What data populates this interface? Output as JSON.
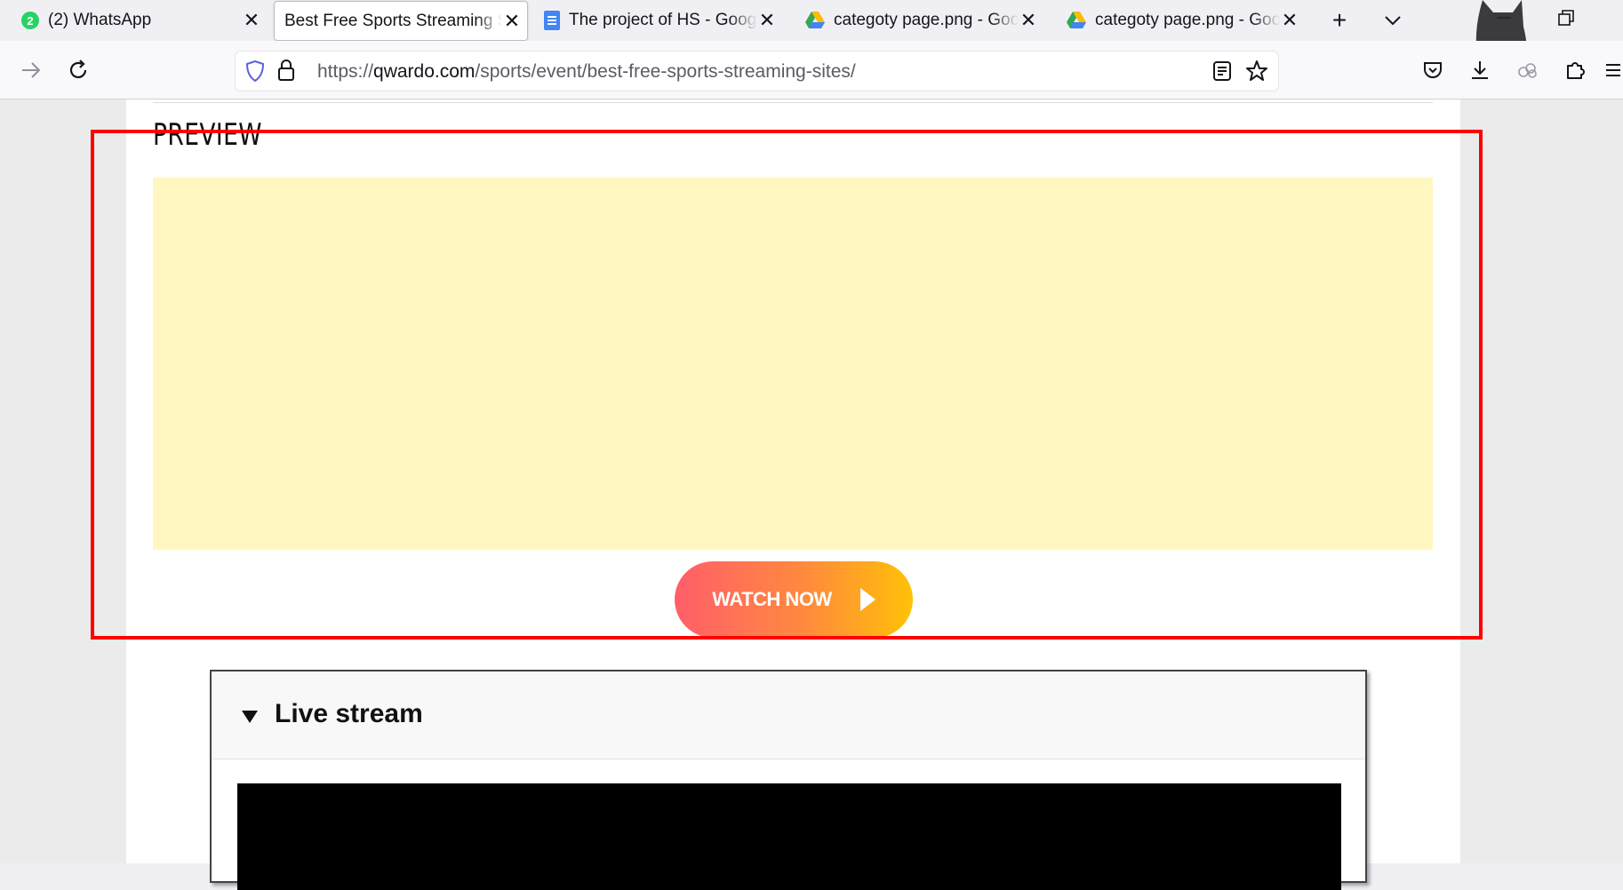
{
  "tabs": [
    {
      "title": "(2) WhatsApp",
      "badge": "2",
      "icon": "whatsapp-icon",
      "active": false
    },
    {
      "title": "Best Free Sports Streaming Sit",
      "icon": "",
      "active": true
    },
    {
      "title": "The project of HS - Googl",
      "icon": "google-docs-icon",
      "active": false
    },
    {
      "title": "categoty page.png - Goog",
      "icon": "google-drive-icon",
      "active": false
    },
    {
      "title": "categoty page.png - Goog",
      "icon": "google-drive-icon",
      "active": false
    }
  ],
  "url": {
    "scheme": "https://",
    "host": "qwardo.com",
    "path": "/sports/event/best-free-sports-streaming-sites/"
  },
  "page": {
    "preview_heading": "PREVIEW",
    "watch_button": "WATCH NOW",
    "live_stream_title": "Live stream"
  },
  "colors": {
    "preview_box": "#fff7bf",
    "watch_gradient_start": "#ff5e6a",
    "watch_gradient_end": "#ffc107",
    "highlight_frame": "#ff0000"
  }
}
